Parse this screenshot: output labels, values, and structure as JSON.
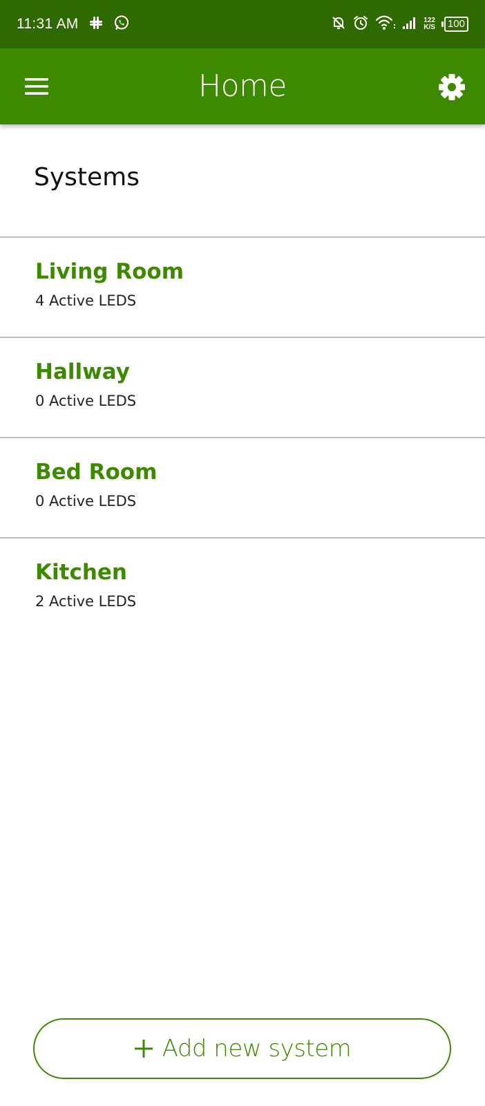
{
  "status_bar": {
    "time": "11:31 AM",
    "net_speed_value": "122",
    "net_speed_unit": "K/S",
    "battery": "100",
    "icons": [
      "slack-icon",
      "whatsapp-icon",
      "notifications-off-icon",
      "alarm-icon",
      "wifi-icon",
      "signal-icon"
    ]
  },
  "app_bar": {
    "title": "Home",
    "menu_icon": "hamburger-menu-icon",
    "settings_icon": "gear-icon"
  },
  "main": {
    "section_title": "Systems",
    "systems": [
      {
        "name": "Living Room",
        "status": "4 Active LEDS"
      },
      {
        "name": "Hallway",
        "status": "0 Active LEDS"
      },
      {
        "name": "Bed Room",
        "status": "0 Active LEDS"
      },
      {
        "name": "Kitchen",
        "status": "2 Active LEDS"
      }
    ]
  },
  "add_button": {
    "label": "Add new system",
    "icon": "plus-icon"
  },
  "colors": {
    "status_bar": "#2f6a00",
    "app_bar": "#3d8a00",
    "accent": "#3d8a00",
    "divider": "#bdbdbd"
  }
}
